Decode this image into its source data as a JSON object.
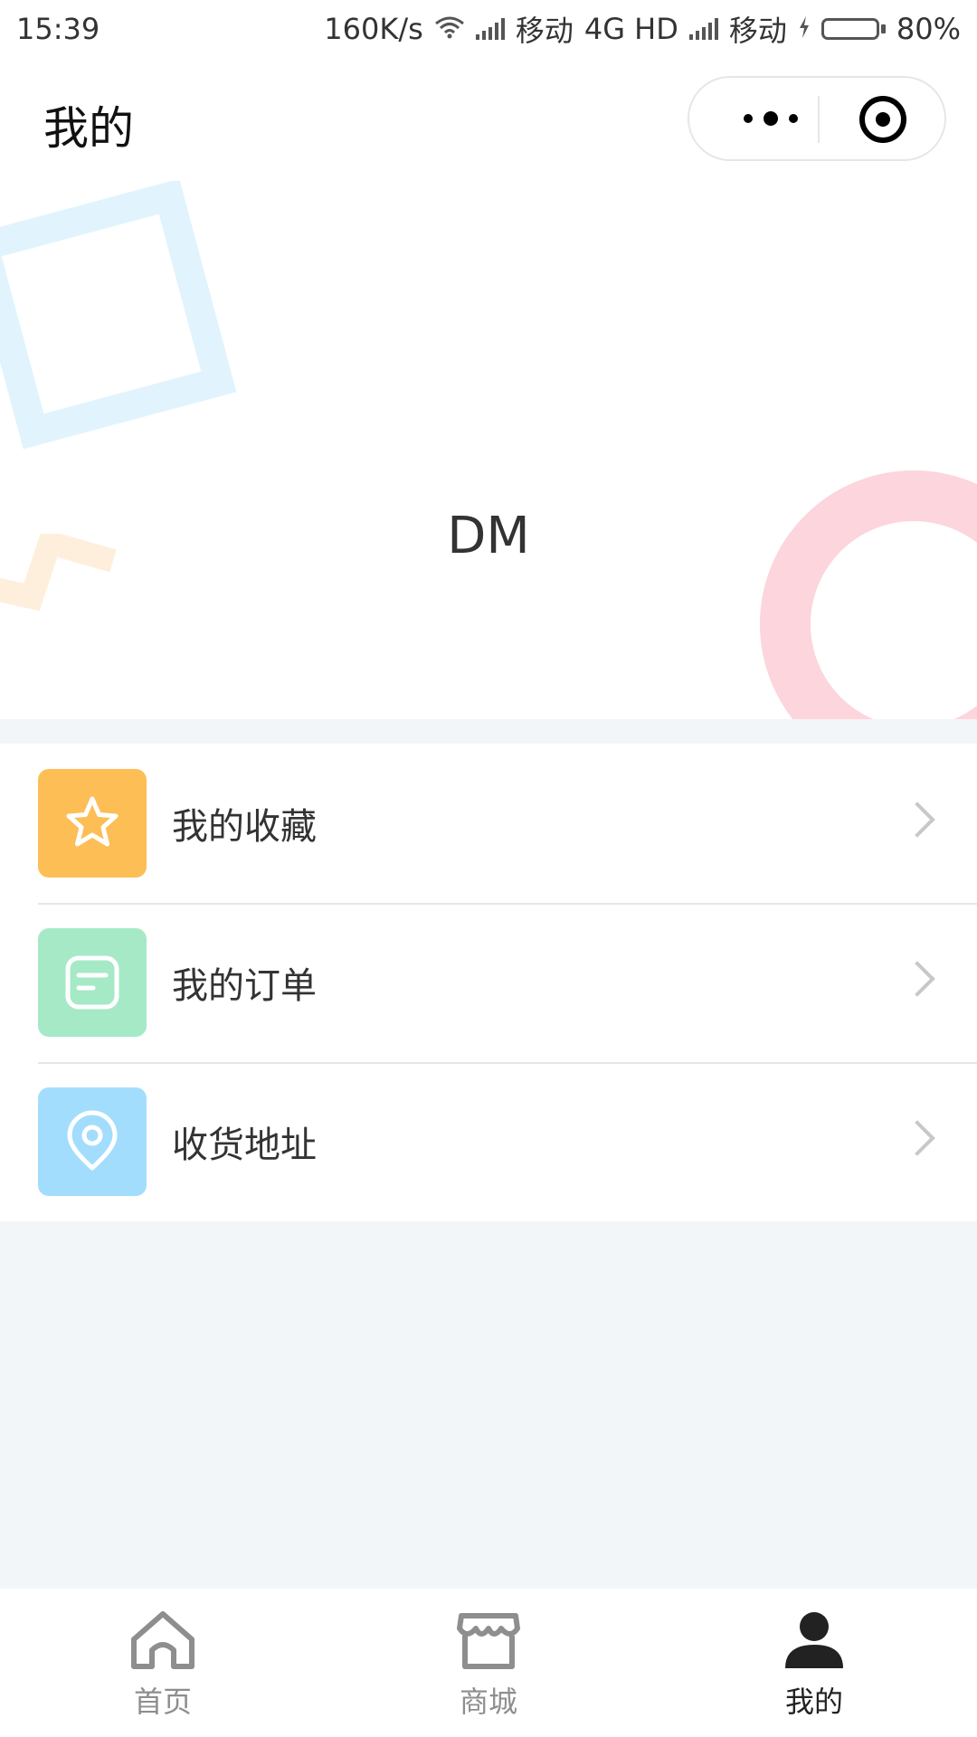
{
  "status_bar": {
    "time": "15:39",
    "net_speed": "160K/s",
    "carrier1": "移动",
    "network": "4G HD",
    "carrier2": "移动",
    "battery": "80%",
    "battery_level": 0.8
  },
  "nav": {
    "title": "我的"
  },
  "profile": {
    "username": "DM"
  },
  "menu": [
    {
      "label": "我的收藏",
      "icon": "star-icon",
      "color": "#fdbe55"
    },
    {
      "label": "我的订单",
      "icon": "order-icon",
      "color": "#a6e9c7"
    },
    {
      "label": "收货地址",
      "icon": "location-icon",
      "color": "#a3ddfd"
    }
  ],
  "tabs": [
    {
      "label": "首页",
      "icon": "home-icon",
      "active": false
    },
    {
      "label": "商城",
      "icon": "store-icon",
      "active": false
    },
    {
      "label": "我的",
      "icon": "user-icon",
      "active": true
    }
  ],
  "colors": {
    "page_bg": "#f3f6f9",
    "deco_blue": "#e1f4fd",
    "deco_pink": "#fdd5dc",
    "deco_orange": "#feefdc"
  }
}
